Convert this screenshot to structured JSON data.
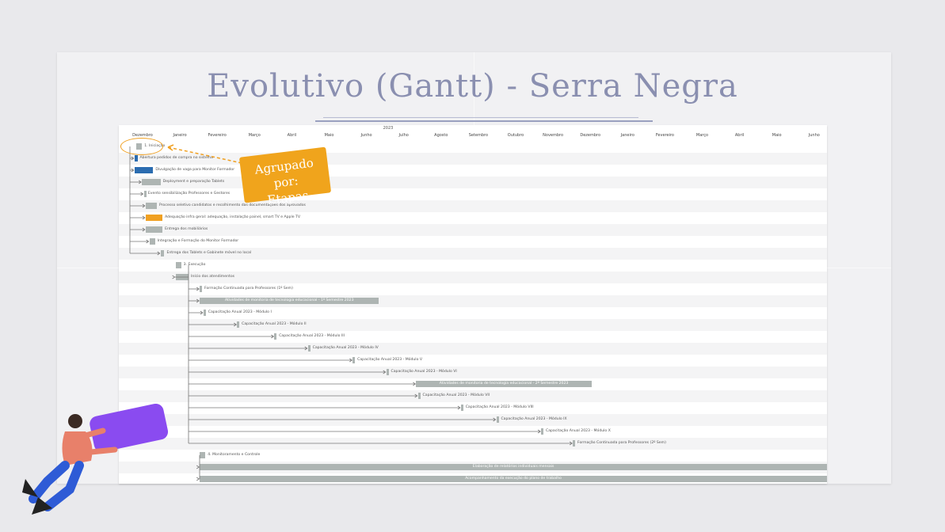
{
  "title": "Evolutivo (Gantt) - Serra Negra",
  "year": "2023",
  "months": [
    "Dezembro",
    "Janeiro",
    "Fevereiro",
    "Março",
    "Abril",
    "Maio",
    "Junho",
    "Julho",
    "Agosto",
    "Setembro",
    "Outubro",
    "Novembro",
    "Dezembro",
    "Janeiro",
    "Fevereiro",
    "Março",
    "Abril",
    "Maio",
    "Junho"
  ],
  "callout": {
    "line1": "Agrupado por:",
    "line2": "Etapas"
  },
  "tasks": [
    {
      "label": "1. Iniciação",
      "start": 0.3,
      "end": 0.45,
      "color": "gray"
    },
    {
      "label": "Abertura pedidos de compra no sistema",
      "start": 0.25,
      "end": 0.33,
      "color": "blue"
    },
    {
      "label": "Divulgação de vaga para Monitor Formador",
      "start": 0.25,
      "end": 0.75,
      "color": "blue"
    },
    {
      "label": "Deployment e preparação Tablets",
      "start": 0.45,
      "end": 0.95,
      "color": "gray"
    },
    {
      "label": "Evento sensibilização Professores e Gestores",
      "start": 0.5,
      "end": 0.55,
      "color": "gray"
    },
    {
      "label": "Processo seletivo candidatos e recolhimento das documentações dos aprovados",
      "start": 0.55,
      "end": 0.85,
      "color": "gray"
    },
    {
      "label": "Adequação infra geral: adequação, instalação painel, smart TV e Apple TV",
      "start": 0.55,
      "end": 1.0,
      "color": "orange"
    },
    {
      "label": "Entrega dos mobiliários",
      "start": 0.55,
      "end": 1.0,
      "color": "gray"
    },
    {
      "label": "Integração e Formação do Monitor Formador",
      "start": 0.65,
      "end": 0.8,
      "color": "gray"
    },
    {
      "label": "Entrega dos Tablets e Gabinete móvel no local",
      "start": 0.95,
      "end": 1.05,
      "color": "gray"
    },
    {
      "label": "3. Execução",
      "start": 1.35,
      "end": 1.5,
      "color": "gray"
    },
    {
      "label": "Início dos atendimentos",
      "start": 1.35,
      "end": 1.7,
      "color": "gray"
    },
    {
      "label": "Formação Continuada para Professores (1º Sem)",
      "start": 2.0,
      "end": 2.06,
      "color": "gray"
    },
    {
      "label": "Atividades de monitoria de tecnologia educacional - 1º Semestre 2023",
      "start": 2.0,
      "end": 6.8,
      "color": "gray",
      "inside": true
    },
    {
      "label": "Capacitação Anual 2023 - Módulo I",
      "start": 2.1,
      "end": 2.16,
      "color": "gray"
    },
    {
      "label": "Capacitação Anual 2023 - Módulo II",
      "start": 3.0,
      "end": 3.06,
      "color": "gray"
    },
    {
      "label": "Capacitação Anual 2023 - Módulo III",
      "start": 4.0,
      "end": 4.06,
      "color": "gray"
    },
    {
      "label": "Capacitação Anual 2023 - Módulo IV",
      "start": 4.9,
      "end": 4.96,
      "color": "gray"
    },
    {
      "label": "Capacitação Anual 2023 - Módulo V",
      "start": 6.1,
      "end": 6.16,
      "color": "gray"
    },
    {
      "label": "Capacitação Anual 2023 - Módulo VI",
      "start": 7.0,
      "end": 7.06,
      "color": "gray"
    },
    {
      "label": "Atividades de monitoria de tecnologia educacional - 2º Semestre 2023",
      "start": 7.8,
      "end": 12.5,
      "color": "gray",
      "inside": true
    },
    {
      "label": "Capacitação Anual 2023 - Módulo VII",
      "start": 7.85,
      "end": 7.91,
      "color": "gray"
    },
    {
      "label": "Capacitação Anual 2023 - Módulo VIII",
      "start": 9.0,
      "end": 9.06,
      "color": "gray"
    },
    {
      "label": "Capacitação Anual 2023 - Módulo IX",
      "start": 9.95,
      "end": 10.01,
      "color": "gray"
    },
    {
      "label": "Capacitação Anual 2023 - Módulo X",
      "start": 11.15,
      "end": 11.21,
      "color": "gray"
    },
    {
      "label": "Formação Continuada para Professores (2º Sem)",
      "start": 12.0,
      "end": 12.06,
      "color": "gray"
    },
    {
      "label": "4. Monitoramento e Controle",
      "start": 2.0,
      "end": 2.15,
      "color": "gray"
    },
    {
      "label": "Elaboração de relatórios individuais mensais",
      "start": 2.0,
      "end": 19.0,
      "color": "gray",
      "inside": true
    },
    {
      "label": "Acompanhamento da execução do plano de trabalho",
      "start": 2.0,
      "end": 19.0,
      "color": "gray",
      "inside": true
    }
  ],
  "colors": {
    "gray": "#aeb5b3",
    "blue": "#2b6cb0",
    "orange": "#f0a021",
    "accent": "#f0a41c"
  }
}
